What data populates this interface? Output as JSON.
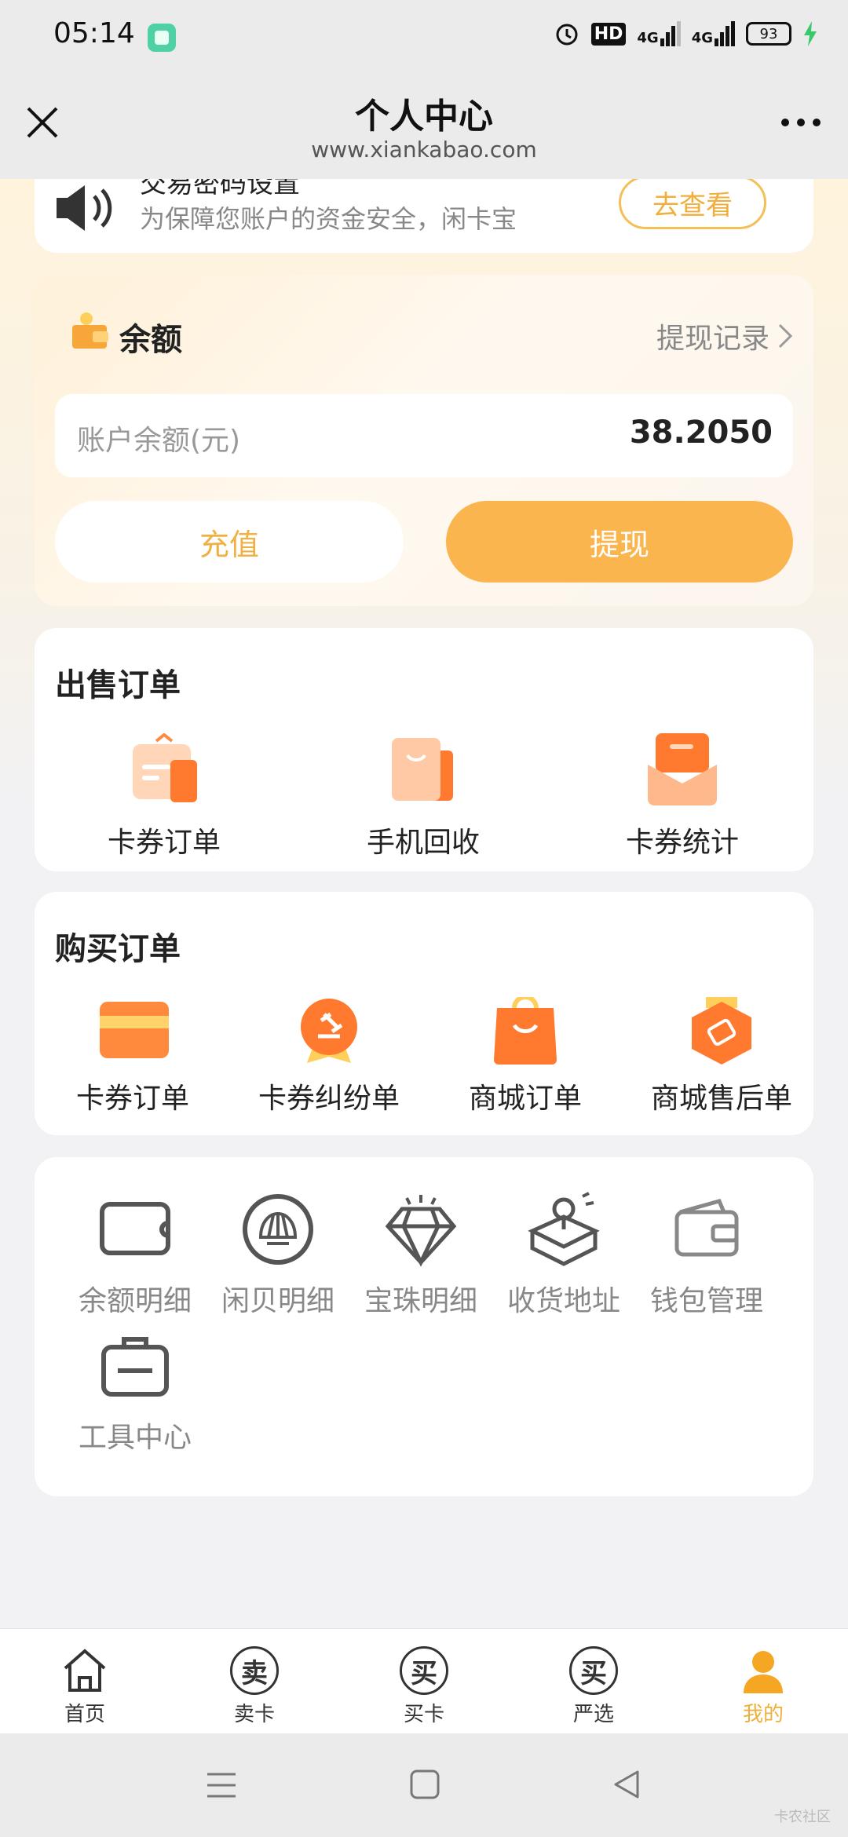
{
  "status_bar": {
    "time": "05:14",
    "hd": "HD",
    "net1": "4G",
    "net2": "4G",
    "battery": "93"
  },
  "nav": {
    "title": "个人中心",
    "subtitle": "www.xiankabao.com"
  },
  "notice": {
    "title": "交易密码设置",
    "text": "为保障您账户的资金安全，闲卡宝",
    "button": "去查看"
  },
  "balance": {
    "title": "余额",
    "record_link": "提现记录",
    "label": "账户余额(元)",
    "value": "38.2050",
    "recharge": "充值",
    "withdraw": "提现"
  },
  "sell_orders": {
    "title": "出售订单",
    "items": [
      {
        "label": "卡券订单",
        "icon": "card-voucher-icon"
      },
      {
        "label": "手机回收",
        "icon": "phone-recycle-bag-icon"
      },
      {
        "label": "卡券统计",
        "icon": "envelope-stats-icon"
      }
    ]
  },
  "buy_orders": {
    "title": "购买订单",
    "items": [
      {
        "label": "卡券订单",
        "icon": "card-icon"
      },
      {
        "label": "卡券纠纷单",
        "icon": "gavel-medal-icon"
      },
      {
        "label": "商城订单",
        "icon": "shopping-bag-icon"
      },
      {
        "label": "商城售后单",
        "icon": "tag-badge-icon"
      }
    ]
  },
  "tools": {
    "items": [
      {
        "label": "余额明细",
        "icon": "wallet-card-icon"
      },
      {
        "label": "闲贝明细",
        "icon": "shell-icon"
      },
      {
        "label": "宝珠明细",
        "icon": "diamond-icon"
      },
      {
        "label": "收货地址",
        "icon": "location-box-icon"
      },
      {
        "label": "钱包管理",
        "icon": "wallet-icon"
      },
      {
        "label": "工具中心",
        "icon": "toolbox-icon"
      }
    ]
  },
  "tabbar": {
    "items": [
      {
        "label": "首页",
        "glyph": ""
      },
      {
        "label": "卖卡",
        "glyph": "卖"
      },
      {
        "label": "买卡",
        "glyph": "买"
      },
      {
        "label": "严选",
        "glyph": "买"
      },
      {
        "label": "我的",
        "glyph": ""
      }
    ],
    "active_index": 4
  },
  "watermark": "卡农社区",
  "colors": {
    "accent": "#fbb54e",
    "accent_text": "#f0ae3a",
    "orange_icon": "#ff7a2e"
  }
}
